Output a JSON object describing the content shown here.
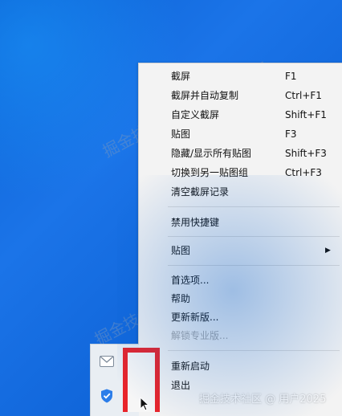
{
  "context_menu": {
    "items": [
      {
        "label": "截屏",
        "shortcut": "F1",
        "enabled": true
      },
      {
        "label": "截屏并自动复制",
        "shortcut": "Ctrl+F1",
        "enabled": true
      },
      {
        "label": "自定义截屏",
        "shortcut": "Shift+F1",
        "enabled": true
      },
      {
        "label": "贴图",
        "shortcut": "F3",
        "enabled": true
      },
      {
        "label": "隐藏/显示所有贴图",
        "shortcut": "Shift+F3",
        "enabled": true
      },
      {
        "label": "切换到另一贴图组",
        "shortcut": "Ctrl+F3",
        "enabled": true
      },
      {
        "label": "清空截屏记录",
        "shortcut": "",
        "enabled": true
      },
      {
        "label": "禁用快捷键",
        "shortcut": "",
        "enabled": true
      },
      {
        "label": "贴图",
        "shortcut": "",
        "enabled": true,
        "submenu": true
      },
      {
        "label": "首选项...",
        "shortcut": "",
        "enabled": true
      },
      {
        "label": "帮助",
        "shortcut": "",
        "enabled": true
      },
      {
        "label": "更新新版...",
        "shortcut": "",
        "enabled": true
      },
      {
        "label": "解锁专业版...",
        "shortcut": "",
        "enabled": false
      },
      {
        "label": "重新启动",
        "shortcut": "",
        "enabled": true
      },
      {
        "label": "退出",
        "shortcut": "",
        "enabled": true
      }
    ],
    "submenu_arrow": "▶"
  },
  "tray": {
    "icons": [
      "mail-icon",
      "shield-icon"
    ]
  },
  "watermarks": {
    "diagonal": "掘金技术社区@用户2025",
    "bottom": "掘金技术社区 @ 用户2025"
  },
  "colors": {
    "desktop": "#1b74e8",
    "menu_bg": "#f3f3f3",
    "highlight": "#e8242a",
    "disabled_text": "#a8a8a8"
  }
}
